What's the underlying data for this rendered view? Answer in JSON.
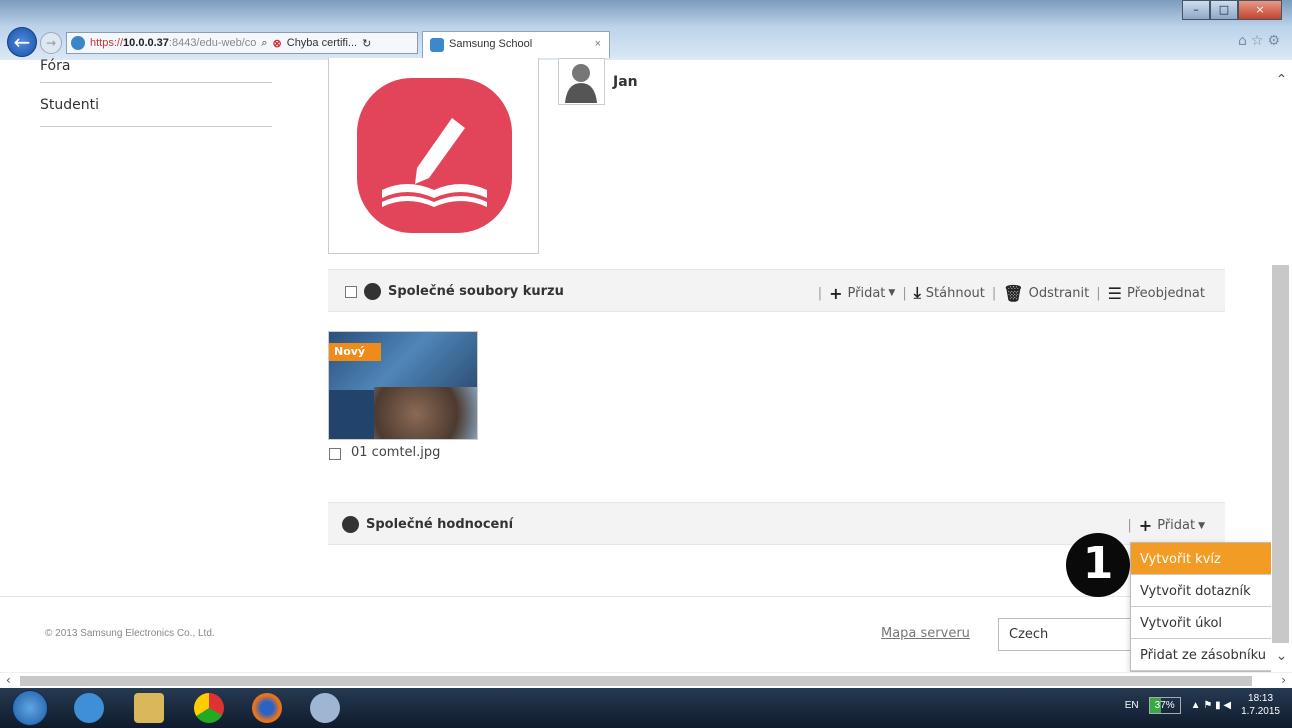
{
  "browser": {
    "url_scheme": "https://",
    "url_host": "10.0.0.37",
    "url_rest": ":8443/edu-web/co",
    "cert_error": "Chyba certifi...",
    "tab_title": "Samsung School",
    "tab_close": "×"
  },
  "sidebar": {
    "items": [
      {
        "label": "Fóra"
      },
      {
        "label": "Studenti"
      }
    ]
  },
  "course": {
    "teacher_name": "Jan"
  },
  "files_section": {
    "title": "Společné soubory kurzu",
    "actions": {
      "add": "Přidat",
      "download": "Stáhnout",
      "delete": "Odstranit",
      "reorder": "Přeobjednat"
    },
    "files": [
      {
        "name": "01 comtel.jpg",
        "badge": "Nový"
      }
    ]
  },
  "grading_section": {
    "title": "Společné hodnocení",
    "add": "Přidat"
  },
  "dropdown": {
    "items": [
      {
        "label": "Vytvořit kvíz",
        "active": true
      },
      {
        "label": "Vytvořit dotazník"
      },
      {
        "label": "Vytvořit úkol"
      },
      {
        "label": "Přidat ze zásobníku"
      }
    ]
  },
  "step_marker": "1",
  "footer": {
    "copyright": "© 2013 Samsung Electronics Co., Ltd.",
    "sitemap": "Mapa serveru",
    "language": "Czech"
  },
  "taskbar": {
    "lang": "EN",
    "battery": "37%",
    "time": "18:13",
    "date": "1.7.2015"
  },
  "colors": {
    "accent": "#f29b25",
    "app_icon": "#e2455a"
  }
}
